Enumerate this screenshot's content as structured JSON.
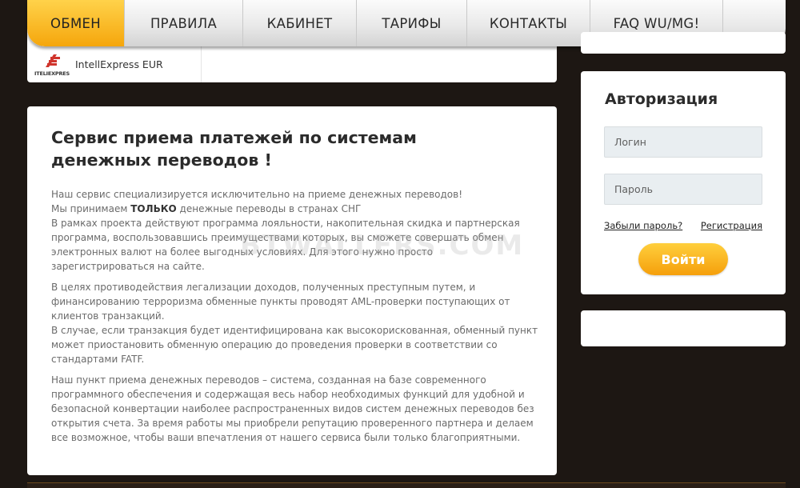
{
  "nav": {
    "items": [
      {
        "label": "ОБМЕН",
        "active": true
      },
      {
        "label": "ПРАВИЛА",
        "active": false
      },
      {
        "label": "КАБИНЕТ",
        "active": false
      },
      {
        "label": "ТАРИФЫ",
        "active": false
      },
      {
        "label": "КОНТАКТЫ",
        "active": false
      },
      {
        "label": "FAQ WU/MG!",
        "active": false
      }
    ]
  },
  "exchange": {
    "logo_text": "ITELIEXPRES",
    "label": "IntellExpress EUR"
  },
  "auth": {
    "title": "Авторизация",
    "login_placeholder": "Логин",
    "password_placeholder": "Пароль",
    "forgot_link": "Забыли пароль?",
    "register_link": "Регистрация",
    "submit_label": "Войти"
  },
  "main": {
    "title": "Сервис приема платежей по системам денежных переводов !",
    "p1": {
      "line1": "Наш сервис специализируется исключительно на приеме денежных переводов!",
      "line2_before": "Мы принимаем ",
      "line2_strong": "ТОЛЬКО",
      "line2_after": " денежные переводы в странах СНГ",
      "line3": "В рамках проекта действуют программа лояльности, накопительная скидка и партнерская программа, воспользовавшись преимуществами которых, вы сможете совершать обмен электронных валют на более выгодных условиях. Для этого нужно просто зарегистрироваться на сайте."
    },
    "p2": {
      "line1": "В целях противодействия легализации доходов, полученных преступным путем, и финансированию терроризма обменные пункты проводят AML-проверки поступающих от клиентов транзакций.",
      "line2": "В случае, если транзакция будет идентифицирована как высокорискованная, обменный пункт может приостановить обменную операцию до проведения проверки в соответствии со стандартами FATF."
    },
    "p3": "Наш пункт приема денежных переводов – система, созданная на базе современного программного обеспечения и содержащая весь набор необходимых функций для удобной и безопасной конвертации наиболее распространенных видов систем денежных переводов без открытия счета. За время работы мы приобрели репутацию проверенного партнера и делаем все возможное, чтобы ваши впечатления от нашего сервиса были только благоприятными."
  },
  "watermark": "BTWALLERS.COM",
  "colors": {
    "accent": "#f5a60c",
    "background": "#1d1713"
  }
}
